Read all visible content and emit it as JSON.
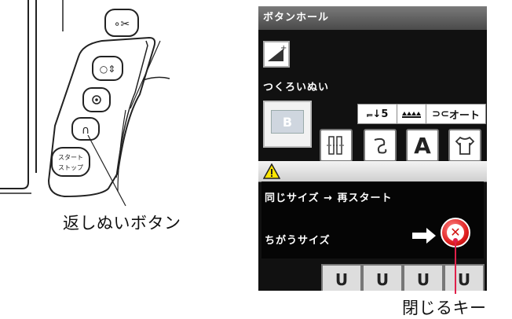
{
  "illustration": {
    "reverse_button_caption": "返しぬいボタン",
    "start_stop_button_label": [
      "スタート",
      "ストップ"
    ]
  },
  "lcd": {
    "title": "ボタンホール",
    "stitch_name": "つくろいぬい",
    "pattern_preview_label": "B",
    "status": {
      "presser_foot": "5",
      "auto_label": "オート"
    },
    "dialog": {
      "message_same_size": "同じサイズ → 再スタート",
      "message_different_size": "ちがうサイズ"
    }
  },
  "close_key_caption": "閉じるキー",
  "colors": {
    "close_key": "#e02020",
    "warning_icon": "#ffe600",
    "callout_line": "#e0204a"
  }
}
